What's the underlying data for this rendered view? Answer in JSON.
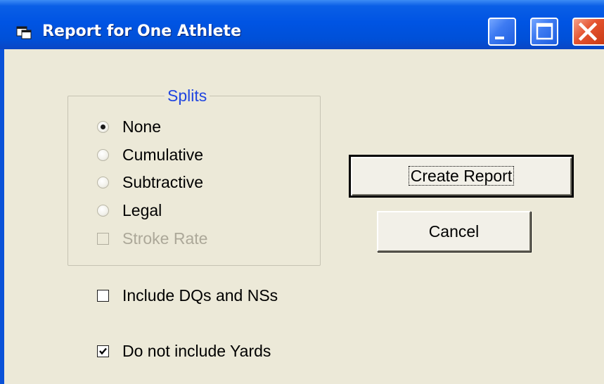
{
  "window": {
    "title": "Report for One Athlete",
    "icon": "app-window-icon",
    "controls": {
      "minimize": "minimize-icon",
      "maximize": "maximize-icon",
      "close": "close-icon"
    }
  },
  "splits": {
    "title": "Splits",
    "selected": "None",
    "options": [
      "None",
      "Cumulative",
      "Subtractive",
      "Legal"
    ],
    "stroke_rate": {
      "label": "Stroke Rate",
      "checked": false,
      "enabled": false
    }
  },
  "options": {
    "include_dqs": {
      "label": "Include DQs and NSs",
      "checked": false
    },
    "no_yards": {
      "label": "Do not include Yards",
      "checked": true
    }
  },
  "buttons": {
    "create_report": "Create Report",
    "cancel": "Cancel"
  },
  "colors": {
    "titlebar": "#0054e3",
    "client_background": "#ece9d8",
    "group_title": "#2146e0",
    "disabled_text": "#aca899",
    "close_button": "#e5532f"
  }
}
